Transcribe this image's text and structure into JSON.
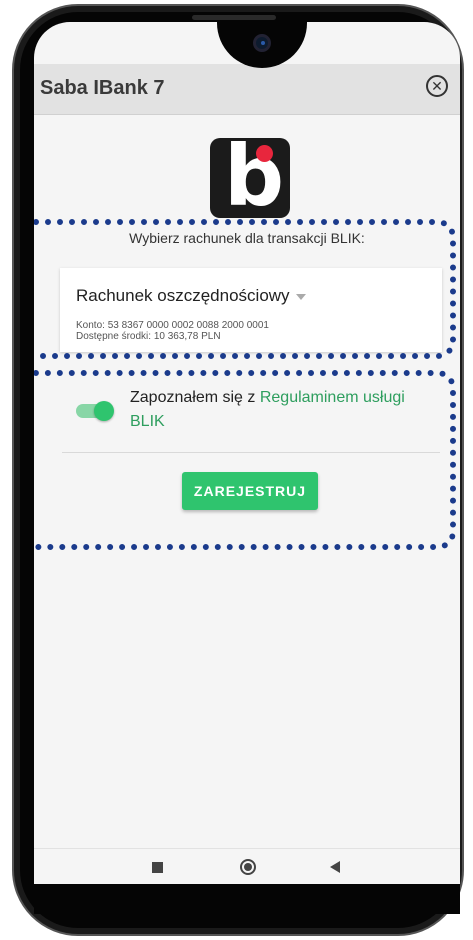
{
  "app": {
    "title": "Saba IBank 7"
  },
  "blik": {
    "prompt": "Wybierz rachunek dla transakcji BLIK:"
  },
  "account": {
    "name": "Rachunek oszczędnościowy",
    "number": "Konto: 53 8367 0000 0002 0088 2000 0001",
    "balance": "Dostępne środki: 10 363,78 PLN"
  },
  "terms": {
    "prefix": "Zapoznałem się z ",
    "link": "Regulaminem usługi BLIK",
    "accepted": true
  },
  "actions": {
    "register_label": "ZAREJESTRUJ"
  },
  "colors": {
    "accent_green": "#2fc46e",
    "link_green": "#2e9e5e",
    "highlight_blue": "#1b3b8c",
    "blik_red": "#e8263d"
  },
  "icons": {
    "close": "close-circle-icon",
    "nav": [
      "recent-apps-icon",
      "home-icon",
      "back-icon"
    ]
  }
}
